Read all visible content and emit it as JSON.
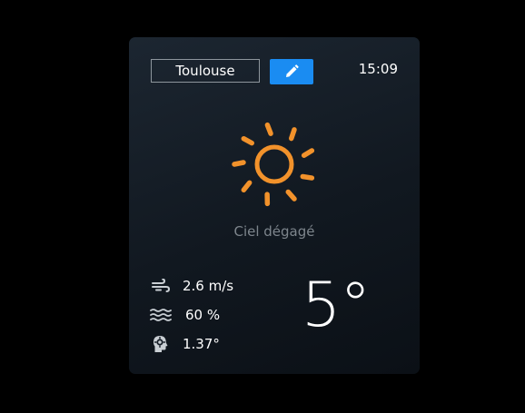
{
  "weather_card": {
    "city_value": "Toulouse",
    "time": "15:09",
    "weather_icon": "sun-icon",
    "condition": "Ciel dégagé",
    "wind": "2.6 m/s",
    "humidity": "60 %",
    "feels_like": "1.37°",
    "temperature": "5°",
    "edit_icon": "pencil-icon"
  },
  "colors": {
    "accent": "#1a8cf2",
    "sun": "#f2922b",
    "card_background": "#151d26",
    "muted_text": "#7d858c"
  }
}
